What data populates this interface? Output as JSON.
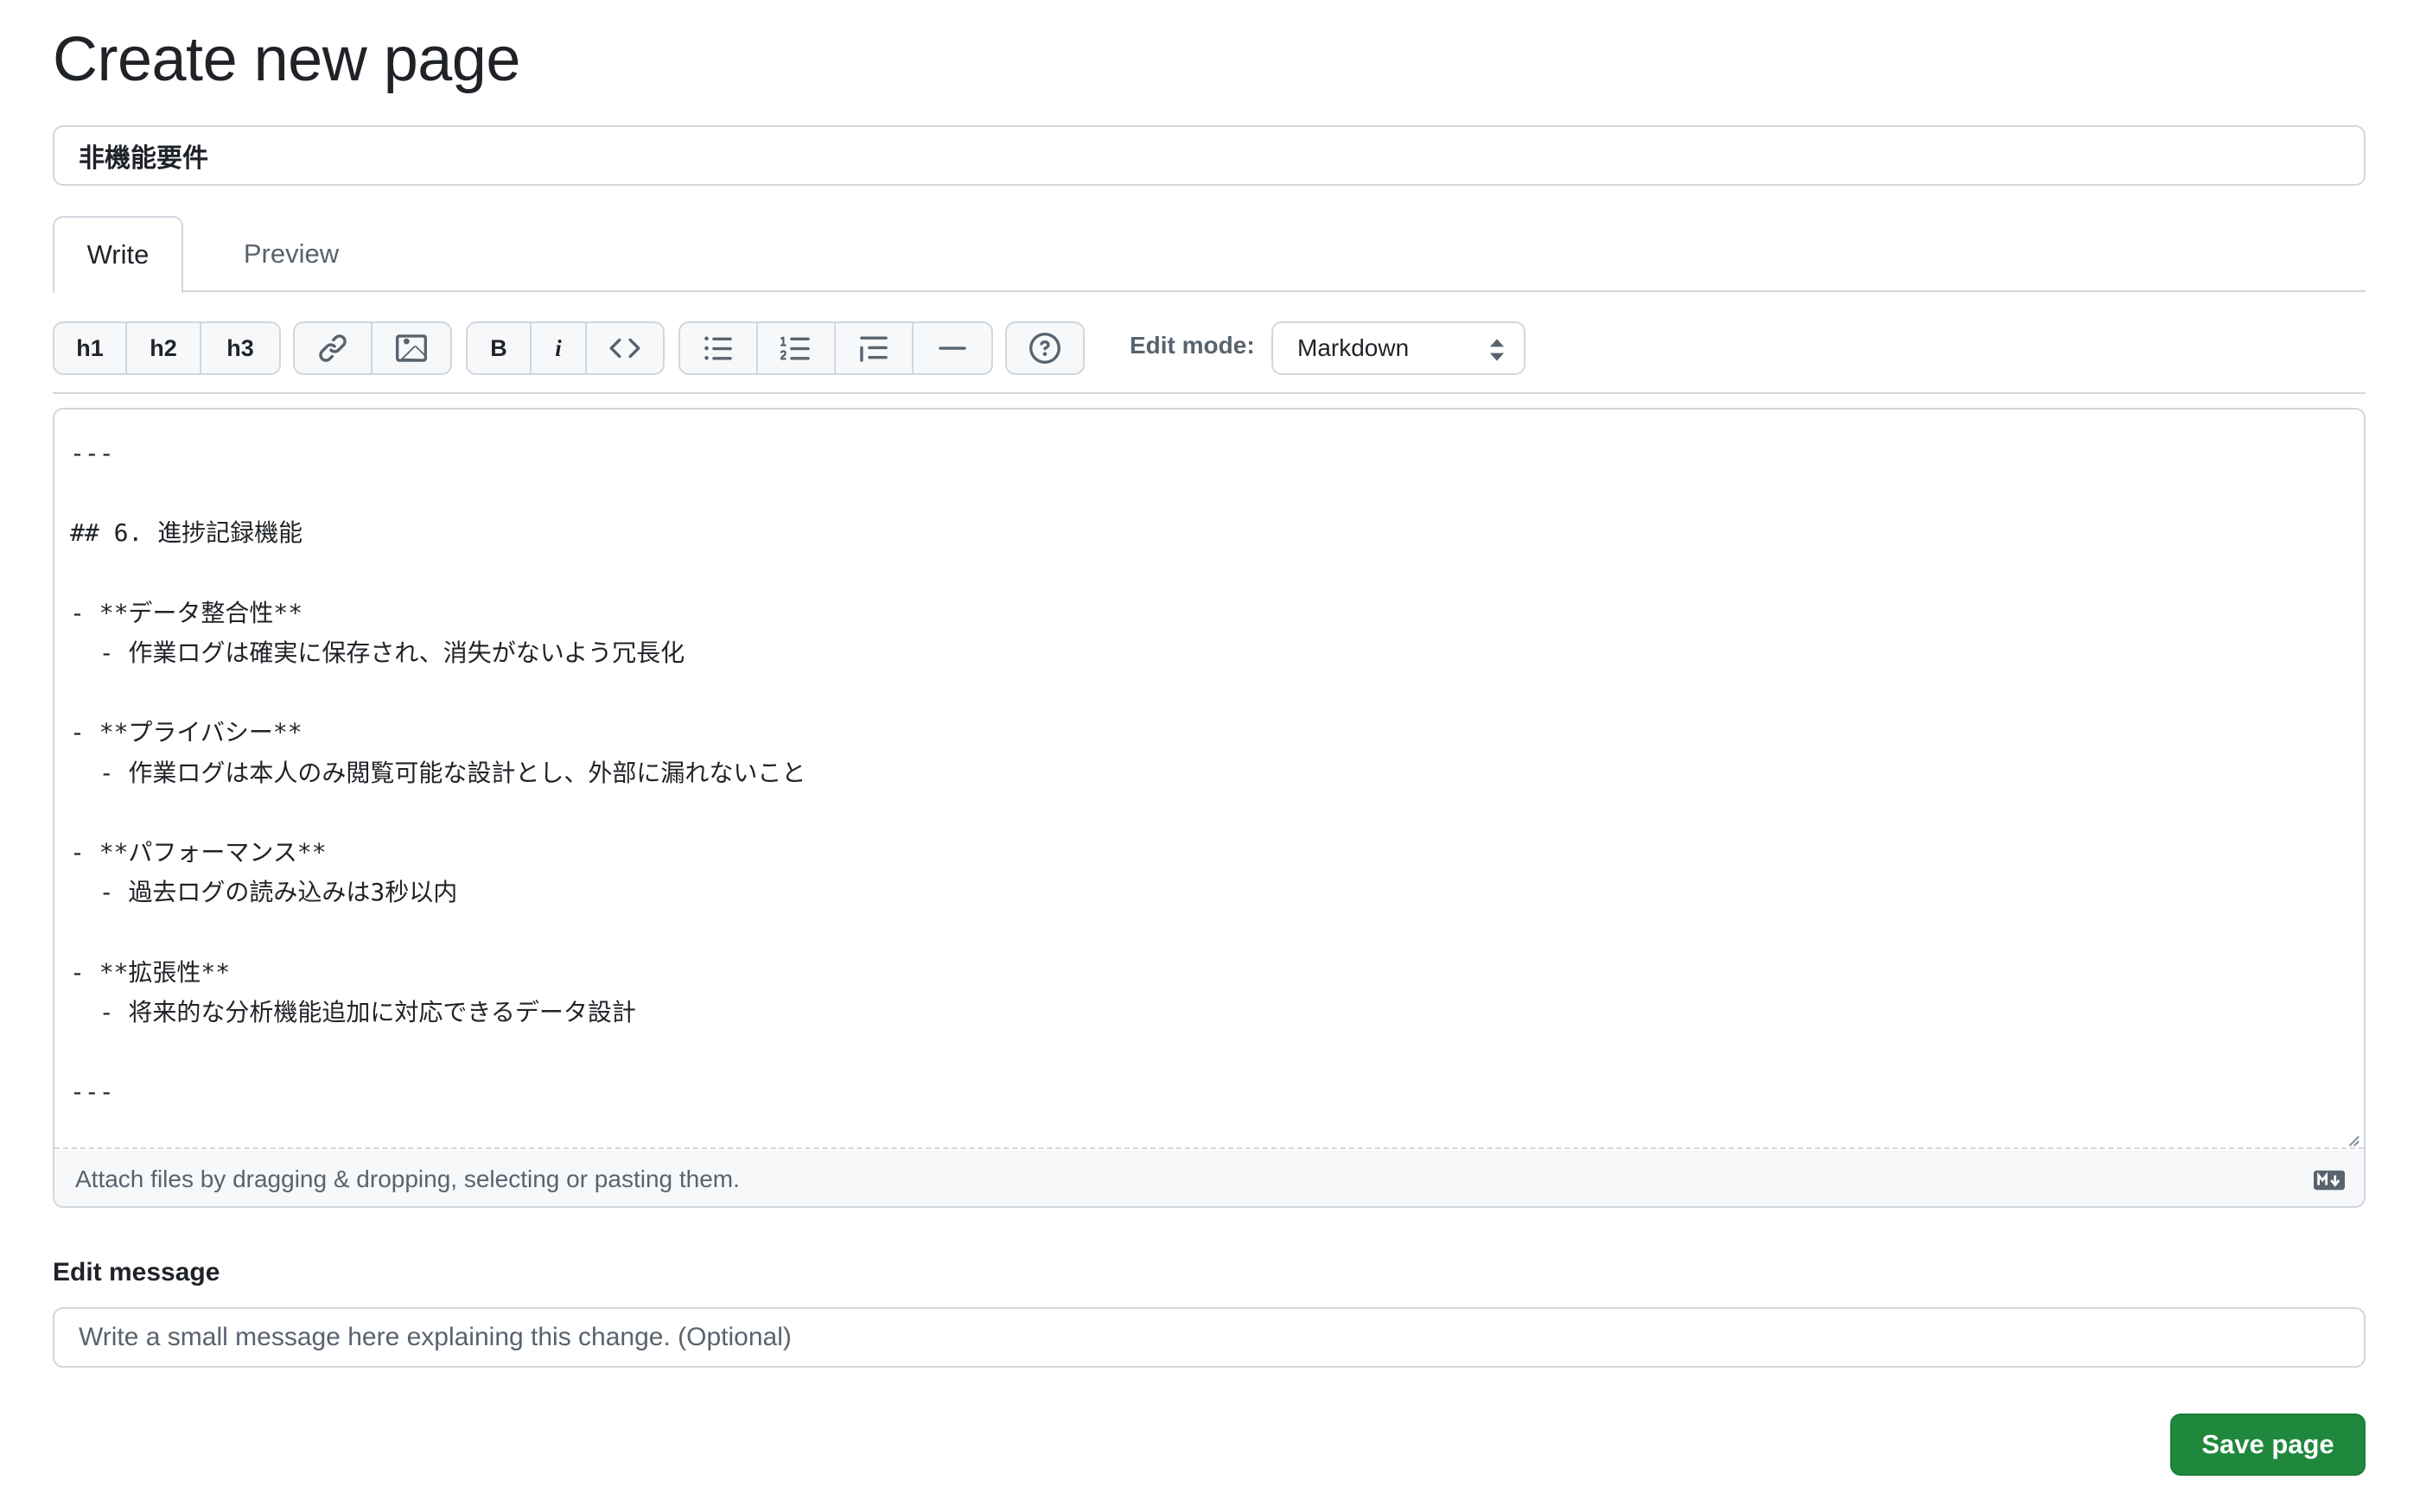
{
  "page": {
    "title": "Create new page",
    "title_value": "非機能要件"
  },
  "tabs": [
    {
      "label": "Write",
      "active": true
    },
    {
      "label": "Preview",
      "active": false
    }
  ],
  "toolbar": {
    "headings": [
      "h1",
      "h2",
      "h3"
    ],
    "bold_label": "B",
    "italic_label": "i",
    "edit_mode_label": "Edit mode:",
    "edit_mode_value": "Markdown",
    "icons": [
      "link-icon",
      "image-icon",
      "code-icon",
      "unordered-list-icon",
      "ordered-list-icon",
      "blockquote-icon",
      "horizontal-rule-icon",
      "help-icon"
    ]
  },
  "editor": {
    "content": "---\n\n## 6. 進捗記録機能\n\n- **データ整合性**\n  - 作業ログは確実に保存され、消失がないよう冗長化\n\n- **プライバシー**\n  - 作業ログは本人のみ閲覧可能な設計とし、外部に漏れないこと\n\n- **パフォーマンス**\n  - 過去ログの読み込みは3秒以内\n\n- **拡張性**\n  - 将来的な分析機能追加に対応できるデータ設計\n\n---",
    "attach_hint": "Attach files by dragging & dropping, selecting or pasting them."
  },
  "edit_message": {
    "label": "Edit message",
    "placeholder": "Write a small message here explaining this change. (Optional)"
  },
  "actions": {
    "save_label": "Save page"
  },
  "colors": {
    "primary_button": "#1f883d",
    "border": "#d0d7de",
    "muted_text": "#59636e"
  }
}
